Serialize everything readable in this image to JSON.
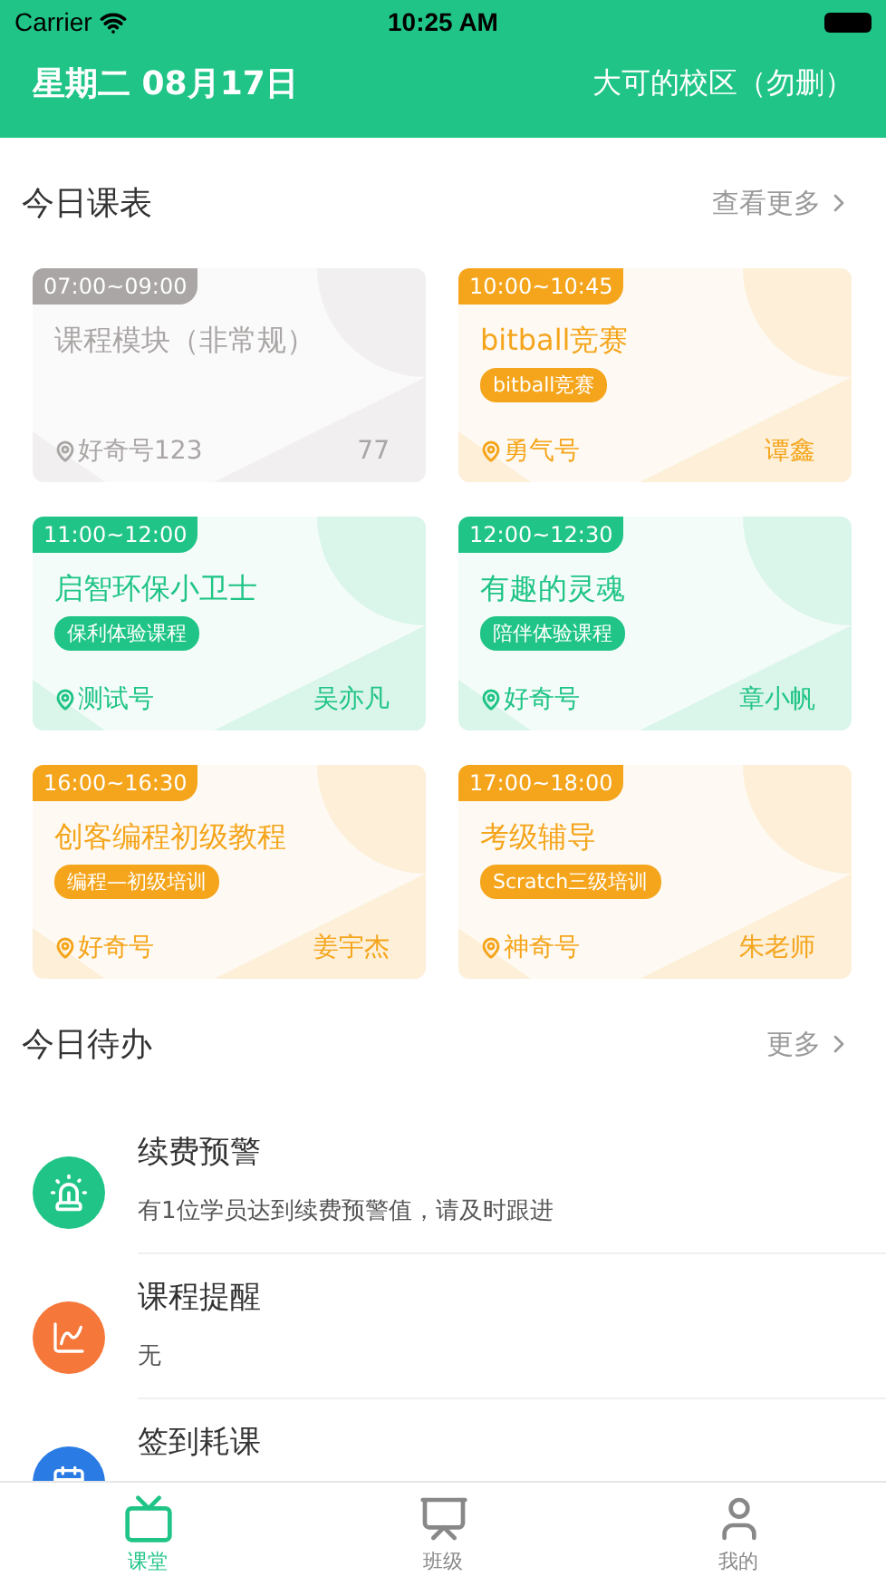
{
  "status_bar": {
    "carrier": "Carrier",
    "time": "10:25 AM"
  },
  "header": {
    "date": "星期二 08月17日",
    "campus": "大可的校区（勿删）"
  },
  "schedule": {
    "title": "今日课表",
    "more": "查看更多",
    "cards": [
      {
        "time": "07:00~09:00",
        "title": "课程模块（非常规）",
        "color": "#aaa6a6",
        "place": "好奇号123",
        "teacher": "77"
      },
      {
        "time": "10:00~10:45",
        "title": "bitball竞赛",
        "tag": "bitball竞赛",
        "color": "#f5a51c",
        "place": "勇气号",
        "teacher": "谭鑫"
      },
      {
        "time": "11:00~12:00",
        "title": "启智环保小卫士",
        "tag": "保利体验课程",
        "color": "#1fc486",
        "place": "测试号",
        "teacher": "吴亦凡"
      },
      {
        "time": "12:00~12:30",
        "title": "有趣的灵魂",
        "tag": "陪伴体验课程",
        "color": "#1fc486",
        "place": "好奇号",
        "teacher": "章小帆"
      },
      {
        "time": "16:00~16:30",
        "title": "创客编程初级教程",
        "tag": "编程—初级培训",
        "color": "#f5a51c",
        "place": "好奇号",
        "teacher": "姜宇杰"
      },
      {
        "time": "17:00~18:00",
        "title": "考级辅导",
        "tag": "Scratch三级培训",
        "color": "#f5a51c",
        "place": "神奇号",
        "teacher": "朱老师"
      }
    ]
  },
  "todo": {
    "title": "今日待办",
    "more": "更多",
    "items": [
      {
        "kind": "alarm",
        "color": "#1fc486",
        "title": "续费预警",
        "detail": "有1位学员达到续费预警值，请及时跟进"
      },
      {
        "kind": "chart",
        "color": "#f5773a",
        "title": "课程提醒",
        "detail": "无"
      },
      {
        "kind": "checkin",
        "color": "#2a7be4",
        "title": "签到耗课"
      }
    ]
  },
  "tabs": [
    {
      "kind": "tv",
      "label": "课堂",
      "selected": true
    },
    {
      "kind": "board",
      "label": "班级",
      "selected": false
    },
    {
      "kind": "person",
      "label": "我的",
      "selected": false
    }
  ]
}
